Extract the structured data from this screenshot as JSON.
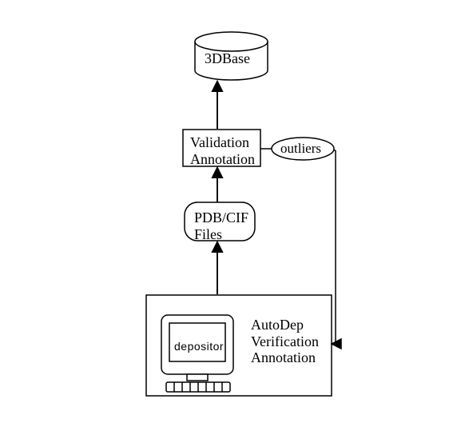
{
  "db": {
    "label": "3DBase"
  },
  "validation_box": {
    "line1": "Validation",
    "line2": "Annotation"
  },
  "outliers": {
    "label": "outliers"
  },
  "files_box": {
    "line1": "PDB/CIF",
    "line2": "Files"
  },
  "autodep": {
    "line1": "AutoDep",
    "line2": "Verification",
    "line3": "Annotation"
  },
  "depositor": {
    "label": "depositor"
  }
}
